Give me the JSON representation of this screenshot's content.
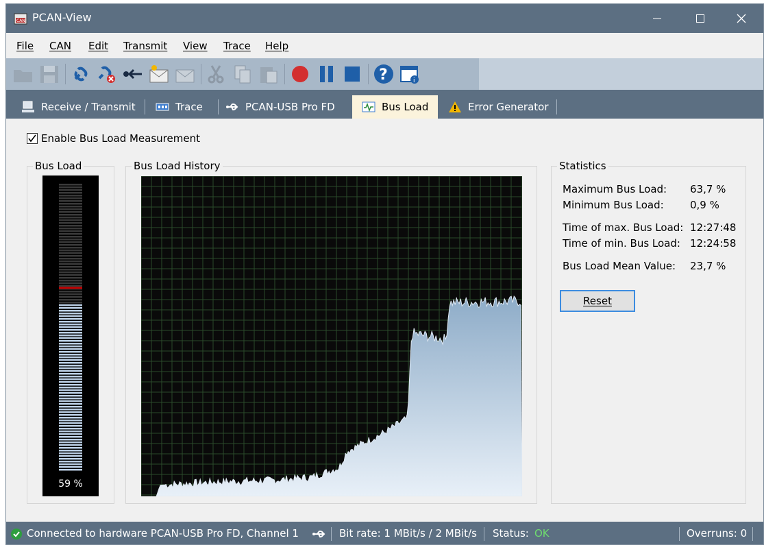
{
  "window": {
    "title": "PCAN-View"
  },
  "menu": [
    "File",
    "CAN",
    "Edit",
    "Transmit",
    "View",
    "Trace",
    "Help"
  ],
  "toolbar": {
    "buttons": [
      "open-icon",
      "save-icon",
      "connect-icon",
      "disconnect-icon",
      "back-icon",
      "new-message-icon",
      "edit-message-icon",
      "cut-icon",
      "copy-icon",
      "paste-icon",
      "record-icon",
      "pause-icon",
      "stop-icon",
      "help-icon",
      "properties-icon"
    ]
  },
  "tabs": [
    {
      "label": "Receive / Transmit",
      "icon": "computer-icon"
    },
    {
      "label": "Trace",
      "icon": "trace-icon"
    },
    {
      "label": "PCAN-USB Pro FD",
      "icon": "usb-icon"
    },
    {
      "label": "Bus Load",
      "icon": "bus-load-icon",
      "active": true
    },
    {
      "label": "Error Generator",
      "icon": "warning-icon"
    }
  ],
  "busload": {
    "enable_label": "Enable Bus Load Measurement",
    "enable_checked": true,
    "meter_title": "Bus Load",
    "meter_value": "59 %",
    "meter_fraction": 0.59,
    "meter_peak_fraction": 0.637,
    "history_title": "Bus Load History",
    "statistics_title": "Statistics",
    "stats": [
      {
        "label": "Maximum Bus Load:",
        "value": "63,7 %"
      },
      {
        "label": "Minimum Bus Load:",
        "value": "0,9 %"
      },
      {
        "label": "Time of max. Bus Load:",
        "value": "12:27:48"
      },
      {
        "label": "Time of min. Bus Load:",
        "value": "12:24:58"
      },
      {
        "label": "Bus Load Mean Value:",
        "value": "23,7 %"
      }
    ],
    "reset_label": "Reset"
  },
  "statusbar": {
    "connection": "Connected to hardware PCAN-USB Pro FD, Channel 1",
    "bitrate": "Bit rate: 1 MBit/s / 2 MBit/s",
    "status_label": "Status:",
    "status_value": "OK",
    "overruns": "Overruns: 0"
  },
  "colors": {
    "titlebar": "#5c6f82",
    "toolbar": "#a8b8c8",
    "active_tab": "#fbf3dc",
    "meter_bar": "#bcd0e6",
    "meter_peak": "#c00000",
    "graph_fill_top": "#8eacc8",
    "graph_fill_bottom": "#e8f0f8",
    "status_ok": "#6fdc6f"
  }
}
